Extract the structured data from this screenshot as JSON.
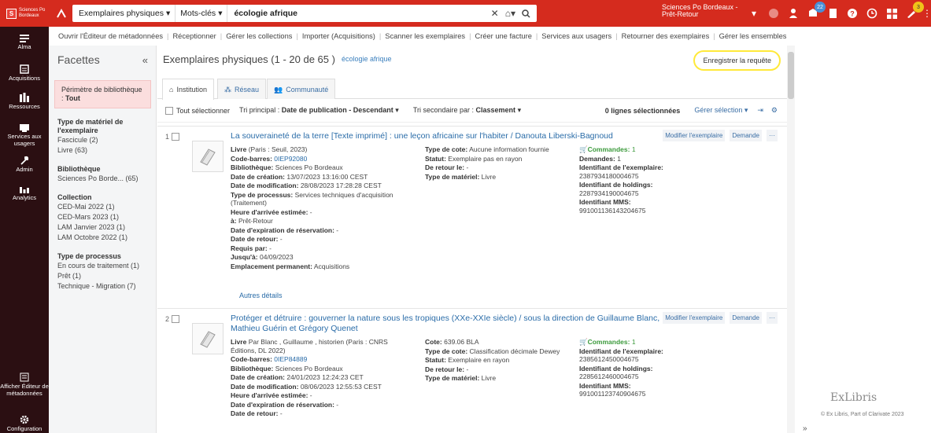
{
  "topbar": {
    "logo_text": "Sciences Po Bordeaux",
    "search_type": "Exemplaires physiques",
    "search_field": "Mots-clés",
    "search_query": "écologie afrique",
    "user_line1": "Sciences Po Bordeaux -",
    "user_line2": "Prêt-Retour",
    "badge_tasks": "22",
    "badge_notifications": "3",
    "accent": "#d52b1e"
  },
  "leftnav": {
    "items": [
      {
        "label": "Alma",
        "icon": "menu-icon"
      },
      {
        "label": "Acquisitions",
        "icon": "acquisitions-icon"
      },
      {
        "label": "Ressources",
        "icon": "resources-icon"
      },
      {
        "label": "Services aux usagers",
        "icon": "user-services-icon"
      },
      {
        "label": "Admin",
        "icon": "admin-icon"
      },
      {
        "label": "Analytics",
        "icon": "analytics-icon"
      },
      {
        "label": "Afficher Éditeur de métadonnées",
        "icon": "metadata-editor-icon"
      },
      {
        "label": "Configuration",
        "icon": "configuration-icon"
      }
    ]
  },
  "menubar": {
    "items": [
      "Ouvrir l'Éditeur de métadonnées",
      "Réceptionner",
      "Gérer les collections",
      "Importer (Acquisitions)",
      "Scanner les exemplaires",
      "Créer une facture",
      "Services aux usagers",
      "Retourner des exemplaires",
      "Gérer les ensembles"
    ]
  },
  "facets": {
    "title": "Facettes",
    "collapse": "«",
    "scope_label": "Périmètre de bibliothèque :",
    "scope_value": "Tout",
    "groups": [
      {
        "title": "Type de matériel de l'exemplaire",
        "values": [
          "Fascicule (2)",
          "Livre (63)"
        ]
      },
      {
        "title": "Bibliothèque",
        "values": [
          "Sciences Po Borde...   (65)"
        ]
      },
      {
        "title": "Collection",
        "values": [
          "CED-Mai 2022 (1)",
          "CED-Mars 2023 (1)",
          "LAM Janvier 2023 (1)",
          "LAM Octobre 2022 (1)"
        ]
      },
      {
        "title": "Type de processus",
        "values": [
          "En cours de traitement (1)",
          "Prêt (1)",
          "Technique - Migration (7)"
        ]
      }
    ]
  },
  "results": {
    "title": "Exemplaires physiques (1 - 20 de 65 )",
    "query": "écologie afrique",
    "save_query": "Enregistrer la requête",
    "tabs": [
      "Institution",
      "Réseau",
      "Communauté"
    ],
    "select_all": "Tout sélectionner",
    "sort_primary_label": "Tri principal :",
    "sort_primary_value": "Date de publication - Descendant",
    "sort_secondary_label": "Tri secondaire par :",
    "sort_secondary_value": "Classement",
    "selected_count": "0 lignes sélectionnées",
    "manage_selection": "Gérer sélection",
    "action_edit": "Modifier l'exemplaire",
    "action_request": "Demande",
    "action_more": "···",
    "more_details": "Autres détails"
  },
  "records": [
    {
      "num": "1",
      "title": "La souveraineté de la terre [Texte imprimé] : une leçon africaine sur l'habiter / Danouta Liberski-Bagnoud",
      "col1": [
        {
          "k": "Livre",
          "v": "(Paris : Seuil, 2023)"
        },
        {
          "k": "Code-barres:",
          "v": "0IEP92080",
          "link": true
        },
        {
          "k": "Bibliothèque:",
          "v": "Sciences Po Bordeaux"
        },
        {
          "k": "Date de création:",
          "v": "13/07/2023 13:16:00 CEST"
        },
        {
          "k": "Date de modification:",
          "v": "28/08/2023 17:28:28 CEST"
        },
        {
          "k": "Type de processus:",
          "v": "Services techniques d'acquisition (Traitement)"
        },
        {
          "k": "Heure d'arrivée estimée:",
          "v": "-"
        },
        {
          "k": "à:",
          "v": "Prêt-Retour"
        },
        {
          "k": "Date d'expiration de réservation:",
          "v": "-"
        },
        {
          "k": "Date de retour:",
          "v": "-"
        },
        {
          "k": "Requis par:",
          "v": "-"
        },
        {
          "k": "Jusqu'à:",
          "v": "04/09/2023"
        },
        {
          "k": "Emplacement permanent:",
          "v": "Acquisitions"
        }
      ],
      "col2": [
        {
          "k": "Type de cote:",
          "v": "Aucune information fournie"
        },
        {
          "k": "Statut:",
          "v": "Exemplaire pas en rayon"
        },
        {
          "k": "De retour le:",
          "v": "-"
        },
        {
          "k": "Type de matériel:",
          "v": "Livre"
        }
      ],
      "col3": [
        {
          "k": "Commandes:",
          "v": "1",
          "green": true
        },
        {
          "k": "Demandes:",
          "v": "1"
        },
        {
          "k": "Identifiant de l'exemplaire:",
          "v": "2387934180004675"
        },
        {
          "k": "Identifiant de holdings:",
          "v": "2287934190004675"
        },
        {
          "k": "Identifiant MMS:",
          "v": "991001136143204675"
        }
      ]
    },
    {
      "num": "2",
      "title": "Protéger et détruire : gouverner la nature sous les tropiques (XXe-XXIe siècle) / sous la direction de Guillaume Blanc, Mathieu Guérin et Grégory Quenet",
      "col1": [
        {
          "k": "Livre",
          "v": "Par Blanc , Guillaume , historien (Paris : CNRS Éditions, DL 2022)"
        },
        {
          "k": "Code-barres:",
          "v": "0IEP84889",
          "link": true
        },
        {
          "k": "Bibliothèque:",
          "v": "Sciences Po Bordeaux"
        },
        {
          "k": "Date de création:",
          "v": "24/01/2023 12:24:23 CET"
        },
        {
          "k": "Date de modification:",
          "v": "08/06/2023 12:55:53 CEST"
        },
        {
          "k": "Heure d'arrivée estimée:",
          "v": "-"
        },
        {
          "k": "Date d'expiration de réservation:",
          "v": "-"
        },
        {
          "k": "Date de retour:",
          "v": "-"
        }
      ],
      "col2": [
        {
          "k": "Cote:",
          "v": "639.06 BLA"
        },
        {
          "k": "Type de cote:",
          "v": "Classification décimale Dewey"
        },
        {
          "k": "Statut:",
          "v": "Exemplaire en rayon"
        },
        {
          "k": "De retour le:",
          "v": "-"
        },
        {
          "k": "Type de matériel:",
          "v": "Livre"
        }
      ],
      "col3": [
        {
          "k": "Commandes:",
          "v": "1",
          "green": true
        },
        {
          "k": "Identifiant de l'exemplaire:",
          "v": "2385612450004675"
        },
        {
          "k": "Identifiant de holdings:",
          "v": "2285612460004675"
        },
        {
          "k": "Identifiant MMS:",
          "v": "991001123740904675"
        }
      ]
    }
  ],
  "footer": {
    "brand": "ExLibris",
    "copyright": "© Ex Libris, Part of Clarivate  2023"
  }
}
